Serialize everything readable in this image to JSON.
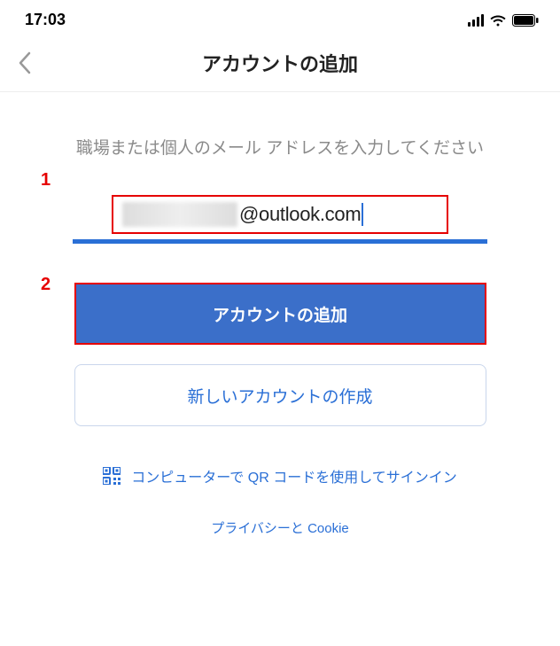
{
  "status": {
    "time": "17:03"
  },
  "nav": {
    "title": "アカウントの追加"
  },
  "instruction": "職場または個人のメール アドレスを入力してください",
  "email": {
    "visible_suffix": "@outlook.com"
  },
  "buttons": {
    "add_account": "アカウントの追加",
    "create_account": "新しいアカウントの作成"
  },
  "qr": {
    "label": "コンピューターで QR コードを使用してサインイン"
  },
  "privacy": {
    "label": "プライバシーと Cookie"
  },
  "markers": {
    "one": "1",
    "two": "2"
  }
}
